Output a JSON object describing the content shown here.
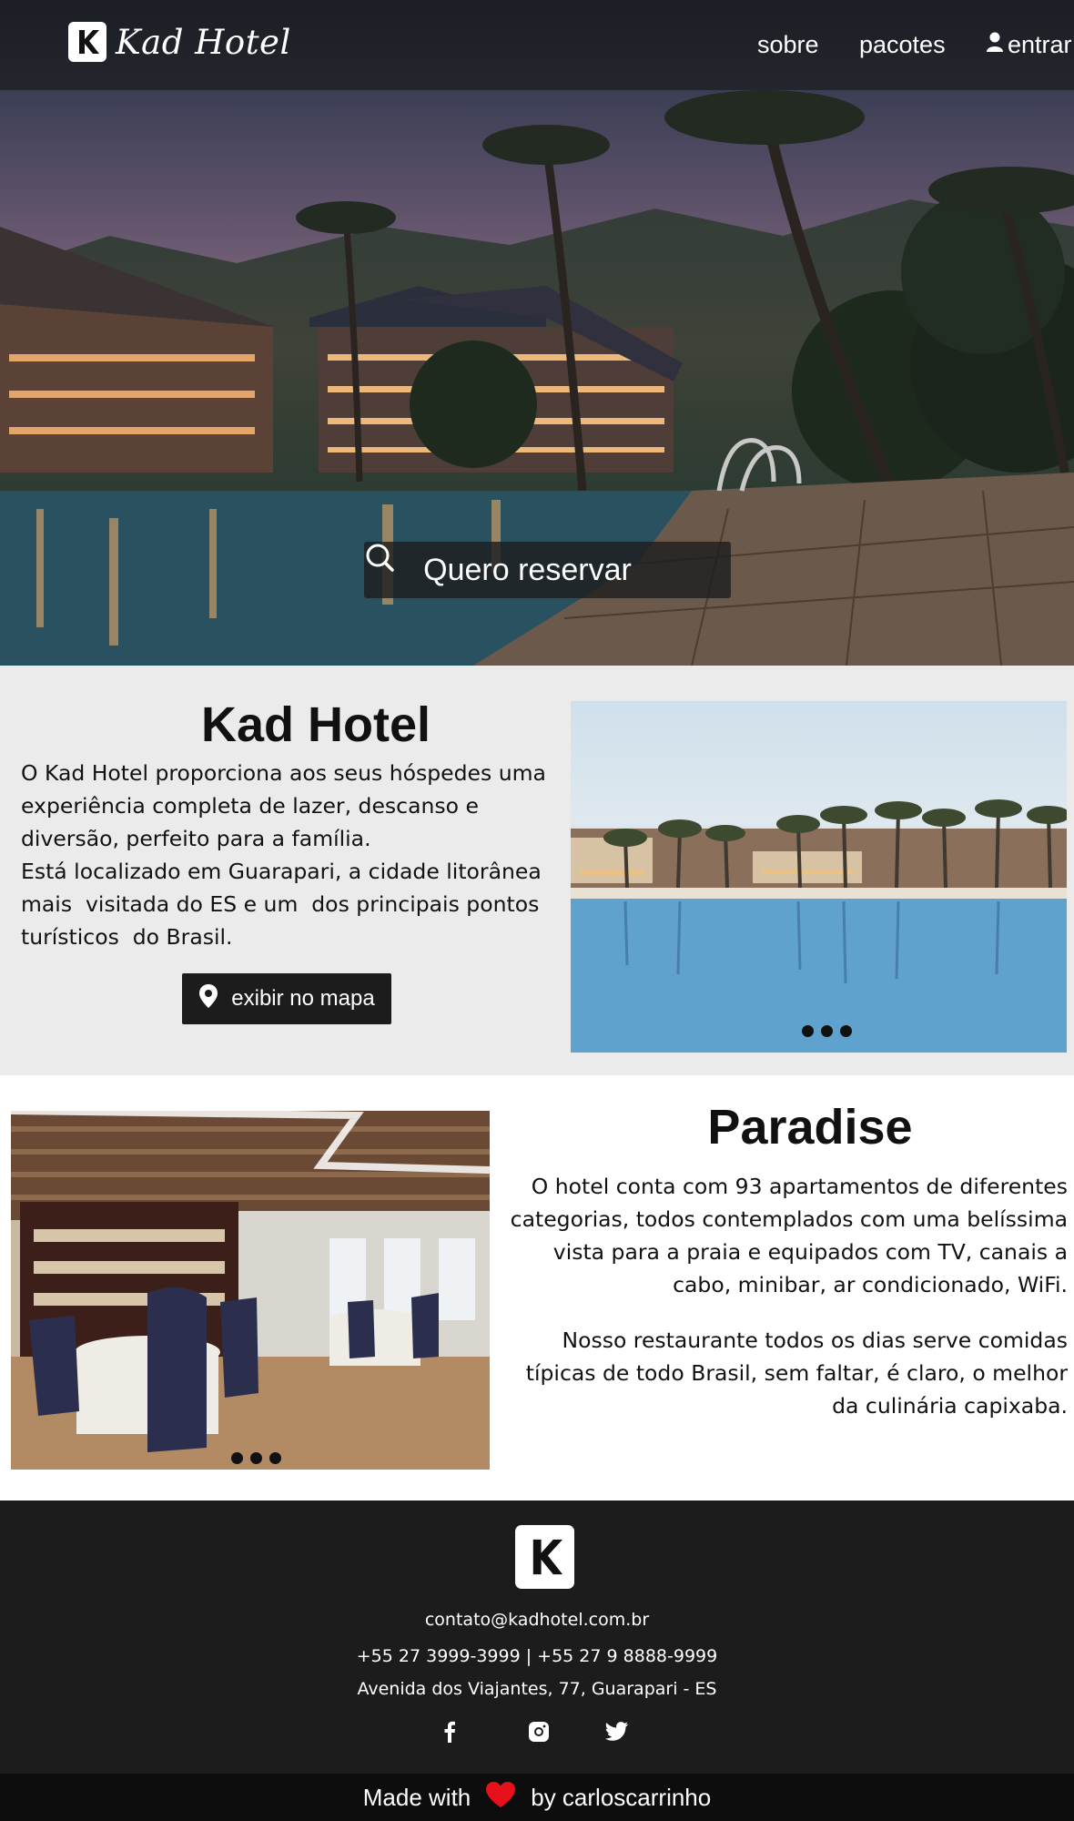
{
  "nav": {
    "brand_name": "Kad Hotel",
    "links": [
      {
        "label": "sobre"
      },
      {
        "label": "pacotes"
      },
      {
        "label": "entrar",
        "icon": "user-icon"
      }
    ]
  },
  "hero": {
    "reserve_label": "Quero reservar",
    "reserve_icon": "search-icon"
  },
  "about": {
    "title": "Kad Hotel",
    "paragraph1": "O Kad Hotel proporciona aos seus hóspedes uma experiência completa de lazer, descanso e diversão, perfeito para a família.",
    "paragraph2": "Está localizado em Guarapari, a cidade litorânea mais  visitada do ES e um  dos principais pontos turísticos  do Brasil.",
    "map_button": "exibir no mapa",
    "map_icon": "map-pin-icon"
  },
  "paradise": {
    "title": "Paradise",
    "paragraph1": "O hotel conta com 93 apartamentos de diferentes categorias, todos contemplados com uma belíssima vista para a praia e equipados com TV, canais a cabo, minibar, ar condicionado, WiFi.",
    "paragraph2": "Nosso restaurante todos os dias serve comidas típicas de todo Brasil, sem faltar, é claro, o melhor da culinária capixaba."
  },
  "footer": {
    "email": "contato@kadhotel.com.br",
    "phones": "+55 27 3999-3999 | +55 27 9 8888-9999",
    "address": "Avenida dos Viajantes, 77, Guarapari - ES",
    "social_icons": [
      "facebook-icon",
      "instagram-icon",
      "twitter-icon"
    ],
    "made_with": "Made with",
    "by": "by carloscarrinho",
    "heart_color": "#e8111b"
  },
  "colors": {
    "navbar": "#1b1e25",
    "about_bg": "#ebebeb",
    "footer_bg": "#1c1c1c",
    "button_dark": "#1c1c1c"
  }
}
